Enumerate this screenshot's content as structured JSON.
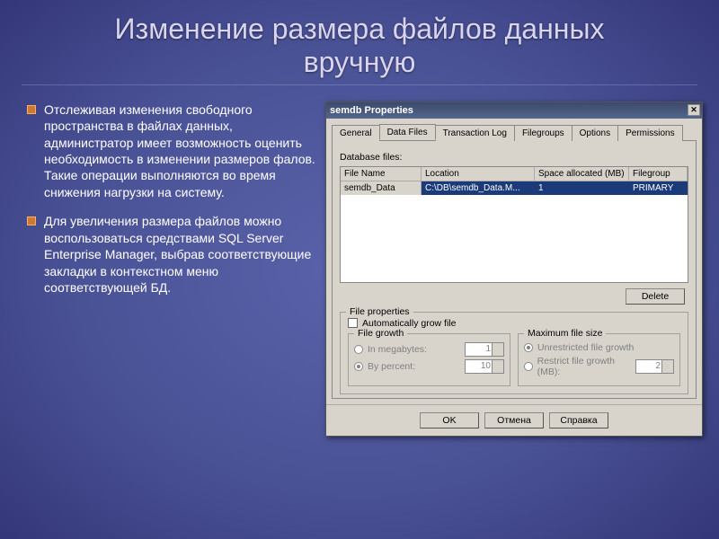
{
  "title": "Изменение размера файлов данных вручную",
  "bullets": [
    "Отслеживая изменения свободного пространства в файлах данных, администратор имеет возможность оценить необходимость в изменении размеров фалов. Такие операции выполняются во время снижения нагрузки на систему.",
    "Для увеличения размера файлов можно воспользоваться средствами SQL Server Enterprise Manager, выбрав соответствующие закладки в контекстном меню соответствующей БД."
  ],
  "dialog": {
    "title": "semdb Properties",
    "close": "✕",
    "tabs": [
      "General",
      "Data Files",
      "Transaction Log",
      "Filegroups",
      "Options",
      "Permissions"
    ],
    "active_tab": "Data Files",
    "section_label": "Database files:",
    "columns": [
      "File Name",
      "Location",
      "Space allocated (MB)",
      "Filegroup"
    ],
    "row": {
      "name": "semdb_Data",
      "location": "C:\\DB\\semdb_Data.M...",
      "space": "1",
      "filegroup": "PRIMARY"
    },
    "delete_btn": "Delete",
    "fileprops_title": "File properties",
    "auto_grow_label": "Automatically grow file",
    "filegrowth_title": "File growth",
    "fg_mb": "In megabytes:",
    "fg_pct": "By percent:",
    "fg_mb_val": "1",
    "fg_pct_val": "10",
    "maxsize_title": "Maximum file size",
    "ms_unrestricted": "Unrestricted file growth",
    "ms_restrict": "Restrict file growth (MB):",
    "ms_val": "2",
    "buttons": {
      "ok": "OK",
      "cancel": "Отмена",
      "help": "Справка"
    }
  }
}
